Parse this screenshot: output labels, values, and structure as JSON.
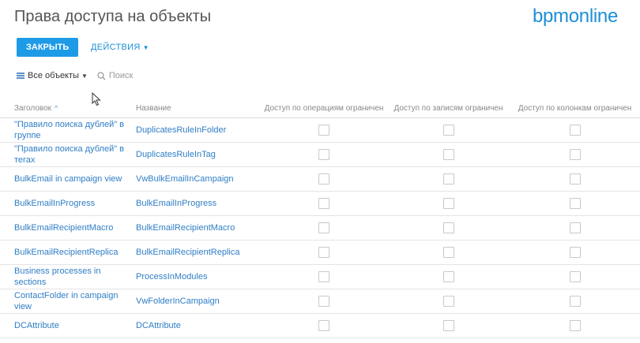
{
  "header": {
    "title": "Права доступа на объекты",
    "logo": "bpmonline"
  },
  "toolbar": {
    "close_label": "ЗАКРЫТЬ",
    "actions_label": "ДЕЙСТВИЯ"
  },
  "filter": {
    "all_objects_label": "Все объекты",
    "search_placeholder": "Поиск"
  },
  "table": {
    "headers": {
      "caption": "Заголовок",
      "name": "Название",
      "ops": "Доступ по операциям ограничен",
      "records": "Доступ по записям ограничен",
      "columns": "Доступ по колонкам ограничен"
    },
    "rows": [
      {
        "caption": "\"Правило поиска дублей\" в группе",
        "name": "DuplicatesRuleInFolder"
      },
      {
        "caption": "\"Правило поиска дублей\" в тегах",
        "name": "DuplicatesRuleInTag"
      },
      {
        "caption": "BulkEmail in campaign view",
        "name": "VwBulkEmailInCampaign"
      },
      {
        "caption": "BulkEmailInProgress",
        "name": "BulkEmailInProgress"
      },
      {
        "caption": "BulkEmailRecipientMacro",
        "name": "BulkEmailRecipientMacro"
      },
      {
        "caption": "BulkEmailRecipientReplica",
        "name": "BulkEmailRecipientReplica"
      },
      {
        "caption": "Business processes in sections",
        "name": "ProcessInModules"
      },
      {
        "caption": "ContactFolder in campaign view",
        "name": "VwFolderInCampaign"
      },
      {
        "caption": "DCAttribute",
        "name": "DCAttribute"
      }
    ]
  },
  "colors": {
    "accent": "#1e9be6",
    "link": "#2f7ec5",
    "logo": "#1e8fd6"
  }
}
